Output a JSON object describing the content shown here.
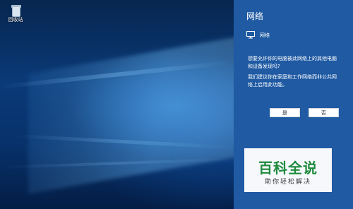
{
  "desktop": {
    "recycle_bin": {
      "label": "回收站",
      "icon": "recycle-bin-icon"
    }
  },
  "network_panel": {
    "title": "网络",
    "network_icon": "network-monitor-icon",
    "network_name": "网络",
    "question": "想要允许你的电脑被此网络上的其他电脑和设备发现吗?",
    "recommendation": "我们建议你在家庭和工作网络而非公共网络上启用此功能。",
    "buttons": {
      "yes": "是",
      "no": "否"
    },
    "colors": {
      "panel_background": "#1f5aa3",
      "button_background": "#ffffff"
    }
  },
  "watermark": {
    "brand": "百科全说",
    "tagline": "助你轻松解决",
    "brand_color": "#1e8a3d"
  }
}
